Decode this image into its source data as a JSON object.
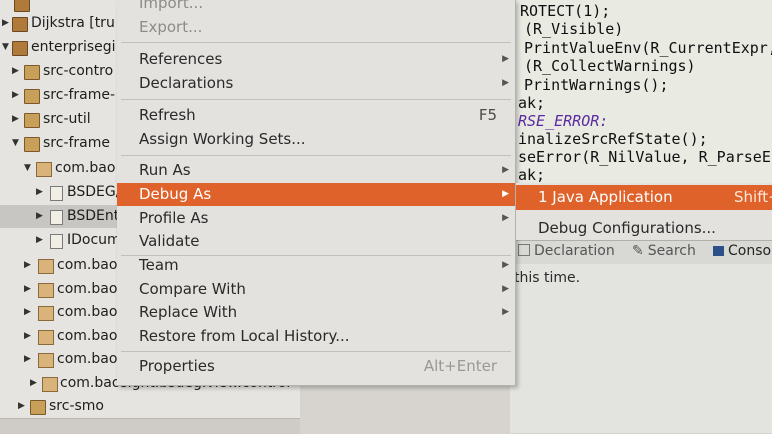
{
  "explorer": {
    "rows": [
      {
        "label": "Dijkstra [tru",
        "indent": 0,
        "icon": "project"
      },
      {
        "label": "enterprisegi",
        "indent": 0,
        "icon": "project"
      },
      {
        "label": "src-contro",
        "indent": 1,
        "icon": "source-folder"
      },
      {
        "label": "src-frame-",
        "indent": 1,
        "icon": "source-folder"
      },
      {
        "label": "src-util",
        "indent": 1,
        "icon": "source-folder"
      },
      {
        "label": "src-frame",
        "indent": 1,
        "icon": "source-folder"
      },
      {
        "label": "com.bao",
        "indent": 2,
        "icon": "package"
      },
      {
        "label": "BSDEG/",
        "indent": 3,
        "icon": "java-file"
      },
      {
        "label": "BSDEnt",
        "indent": 3,
        "icon": "java-file"
      },
      {
        "label": "IDocum",
        "indent": 3,
        "icon": "java-file"
      },
      {
        "label": "com.bao",
        "indent": 2,
        "icon": "package"
      },
      {
        "label": "com.bao",
        "indent": 2,
        "icon": "package"
      },
      {
        "label": "com.bao",
        "indent": 2,
        "icon": "package"
      },
      {
        "label": "com.bao",
        "indent": 2,
        "icon": "package"
      },
      {
        "label": "com.bao",
        "indent": 2,
        "icon": "package"
      },
      {
        "label": "com.baosight.bsdeg.view.control",
        "indent": 2,
        "icon": "package"
      },
      {
        "label": "src-smo",
        "indent": 1,
        "icon": "source-folder"
      }
    ]
  },
  "editor": {
    "lines": [
      "ROTECT(1);",
      "(R_Visible)",
      " PrintValueEnv(R_CurrentExpr, rh",
      "(R_CollectWarnings)",
      " PrintWarnings();",
      "ak;",
      "RSE_ERROR:",
      "inalizeSrcRefState();",
      "seError(R_NilValue, R_ParseError",
      "ak;"
    ]
  },
  "panel": {
    "tab_declaration": "Declaration",
    "tab_search": "Search",
    "tab_console": "Conso",
    "message": "this time."
  },
  "menu": {
    "top_partial_1": "Import...",
    "top_partial_2": "Export...",
    "items": [
      {
        "label": "References",
        "accel": "",
        "submenu": true
      },
      {
        "label": "Declarations",
        "accel": "",
        "submenu": true
      },
      {
        "label": "Refresh",
        "accel": "F5",
        "submenu": false
      },
      {
        "label": "Assign Working Sets...",
        "accel": "",
        "submenu": false
      },
      {
        "label": "Run As",
        "accel": "",
        "submenu": true
      },
      {
        "label": "Debug As",
        "accel": "",
        "submenu": true
      },
      {
        "label": "Profile As",
        "accel": "",
        "submenu": true
      },
      {
        "label": "Validate",
        "accel": "",
        "submenu": false
      },
      {
        "label": "Team",
        "accel": "",
        "submenu": true
      },
      {
        "label": "Compare With",
        "accel": "",
        "submenu": true
      },
      {
        "label": "Replace With",
        "accel": "",
        "submenu": true
      },
      {
        "label": "Restore from Local History...",
        "accel": "",
        "submenu": false
      },
      {
        "label": "Properties",
        "accel": "Alt+Enter",
        "submenu": false
      }
    ],
    "highlight_color": "#e0622b"
  },
  "submenu": {
    "items": [
      {
        "label": "1 Java Application",
        "accel": "Shift+"
      },
      {
        "label": "Debug Configurations...",
        "accel": ""
      }
    ]
  }
}
